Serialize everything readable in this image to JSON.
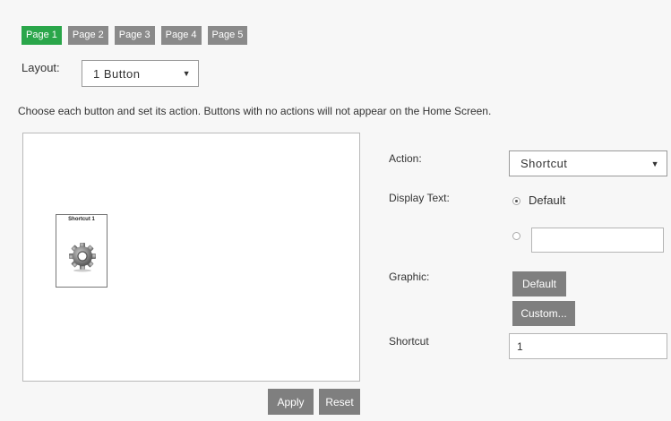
{
  "tabs": [
    "Page 1",
    "Page 2",
    "Page 3",
    "Page 4",
    "Page 5"
  ],
  "active_tab": "Page 1",
  "layout": {
    "label": "Layout:",
    "value": "1 Button"
  },
  "instructions": "Choose each button and set its action. Buttons with no actions will not appear on the Home Screen.",
  "tile": {
    "label": "Shortcut 1",
    "icon": "gear-icon"
  },
  "buttons": {
    "apply": "Apply",
    "reset": "Reset"
  },
  "action": {
    "label": "Action:",
    "value": "Shortcut"
  },
  "display_text": {
    "label": "Display Text:",
    "default_option": "Default",
    "custom_value": ""
  },
  "graphic": {
    "label": "Graphic:",
    "default_button": "Default",
    "custom_button": "Custom..."
  },
  "shortcut": {
    "label": "Shortcut",
    "value": "1"
  },
  "colors": {
    "active_tab": "#2aa64a",
    "tab": "#8a8a8a",
    "button": "#7f7f7f"
  }
}
